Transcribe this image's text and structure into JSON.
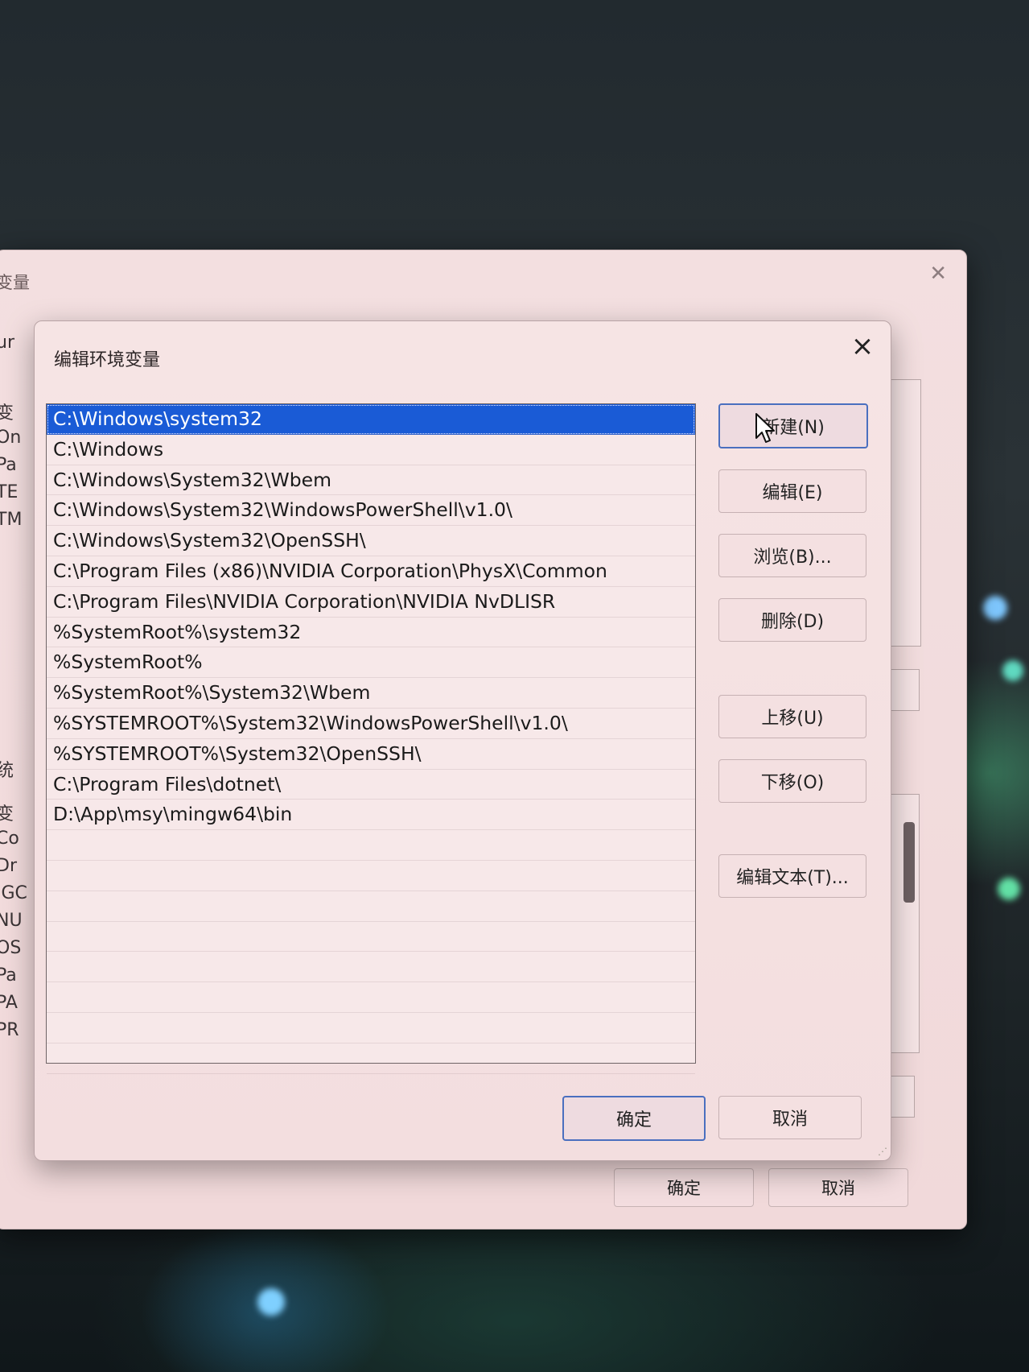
{
  "outer_window": {
    "title": "变量",
    "close_icon": "close-icon",
    "peek_labels": [
      "ur",
      "变",
      "On",
      "Pa",
      "TE",
      "TM",
      "统",
      "变",
      "Co",
      "Dr",
      "IGC",
      "NU",
      "OS",
      "Pa",
      "PA",
      "PR"
    ],
    "ok_label": "确定",
    "cancel_label": "取消"
  },
  "dialog": {
    "title": "编辑环境变量",
    "close_icon": "close-icon",
    "selected_index": 0,
    "paths": [
      "C:\\Windows\\system32",
      "C:\\Windows",
      "C:\\Windows\\System32\\Wbem",
      "C:\\Windows\\System32\\WindowsPowerShell\\v1.0\\",
      "C:\\Windows\\System32\\OpenSSH\\",
      "C:\\Program Files (x86)\\NVIDIA Corporation\\PhysX\\Common",
      "C:\\Program Files\\NVIDIA Corporation\\NVIDIA NvDLISR",
      "%SystemRoot%\\system32",
      "%SystemRoot%",
      "%SystemRoot%\\System32\\Wbem",
      "%SYSTEMROOT%\\System32\\WindowsPowerShell\\v1.0\\",
      "%SYSTEMROOT%\\System32\\OpenSSH\\",
      "C:\\Program Files\\dotnet\\",
      "D:\\App\\msy\\mingw64\\bin"
    ],
    "buttons": {
      "new": "新建(N)",
      "edit": "编辑(E)",
      "browse": "浏览(B)...",
      "delete": "删除(D)",
      "move_up": "上移(U)",
      "move_down": "下移(O)",
      "edit_text": "编辑文本(T)..."
    },
    "ok_label": "确定",
    "cancel_label": "取消"
  }
}
